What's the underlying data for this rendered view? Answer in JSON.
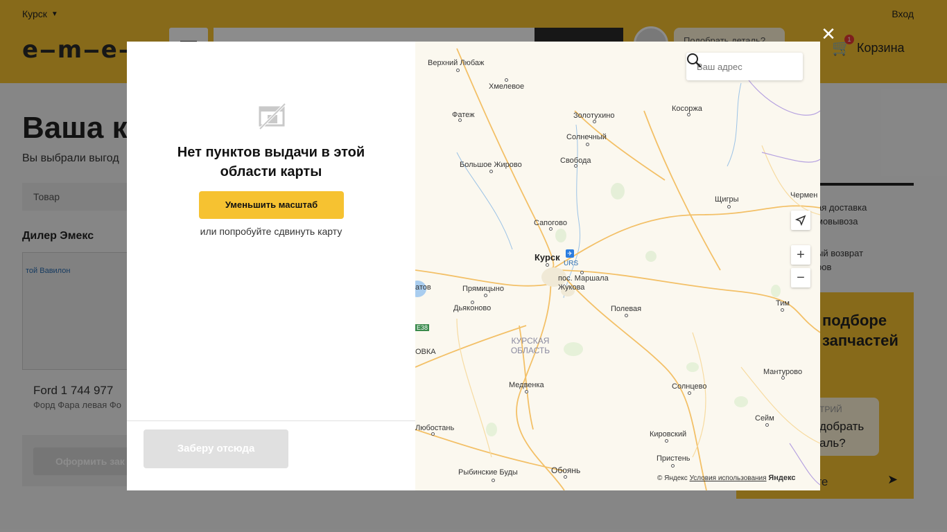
{
  "header": {
    "city": "Курск",
    "login": "Вход",
    "logo": "e‒m‒e‒x",
    "help_placeholder": "Подобрать деталь?",
    "cart_label": "Корзина",
    "cart_count": "1"
  },
  "page": {
    "title": "Ваша ко",
    "subtitle": "Вы выбрали выгод",
    "table_head": "Товар",
    "dealer": "Дилер Эмекс",
    "minimap_label": "той Вавилон",
    "product_name": "Ford 1 744 977",
    "product_desc": "Форд Фара левая Фо",
    "order_button": "Оформить зак",
    "right_col": {
      "line1": "ая доставка",
      "line2": "мовывоза",
      "line3": "ый возврат",
      "line4": "ров"
    },
    "promo": {
      "title": "подборе\nзапчастей",
      "chat_who": "ТРИЙ",
      "chat_msg": "добрать\nаль?",
      "input_text": "авайте"
    }
  },
  "modal": {
    "no_points_title": "Нет пунктов выдачи в этой области карты",
    "zoom_out_button": "Уменьшить масштаб",
    "or_text": "или попробуйте сдвинуть карту",
    "pickup_button": "Заберу отсюда",
    "address_placeholder": "Ваш адрес",
    "copyright": "© Яндекс",
    "terms_link": "Условия использования",
    "yandex_logo": "Яндекс"
  },
  "map": {
    "places": [
      {
        "name": "Верхний Любаж",
        "type": "town"
      },
      {
        "name": "Хмелевое",
        "type": "town"
      },
      {
        "name": "Фатеж",
        "type": "town"
      },
      {
        "name": "Золотухино",
        "type": "town"
      },
      {
        "name": "Косоржа",
        "type": "town"
      },
      {
        "name": "Солнечный",
        "type": "town"
      },
      {
        "name": "Свобода",
        "type": "town"
      },
      {
        "name": "Большое Жирово",
        "type": "town"
      },
      {
        "name": "Щигры",
        "type": "town"
      },
      {
        "name": "Чермен",
        "type": "town"
      },
      {
        "name": "Сапогово",
        "type": "town"
      },
      {
        "name": "Курск",
        "type": "city"
      },
      {
        "name": "URS",
        "type": "airport"
      },
      {
        "name": "пос. Маршала Жукова",
        "type": "town"
      },
      {
        "name": "атов",
        "type": "town"
      },
      {
        "name": "Прямицыно",
        "type": "town"
      },
      {
        "name": "Дьяконово",
        "type": "town"
      },
      {
        "name": "Полевая",
        "type": "town"
      },
      {
        "name": "Тим",
        "type": "town"
      },
      {
        "name": "E38",
        "type": "road"
      },
      {
        "name": "ОВКА",
        "type": "town"
      },
      {
        "name": "КУРСКАЯ ОБЛАСТЬ",
        "type": "region"
      },
      {
        "name": "Мантурово",
        "type": "town"
      },
      {
        "name": "Медвенка",
        "type": "town"
      },
      {
        "name": "Солнцево",
        "type": "town"
      },
      {
        "name": "Сейм",
        "type": "town"
      },
      {
        "name": "Любостань",
        "type": "town"
      },
      {
        "name": "Кировский",
        "type": "town"
      },
      {
        "name": "Пристень",
        "type": "town"
      },
      {
        "name": "Рыбинские Буды",
        "type": "town"
      },
      {
        "name": "Обоянь",
        "type": "town"
      }
    ]
  },
  "colors": {
    "brand": "#f6c231",
    "dark": "#2a2a2a",
    "disabled": "#e0e0e0",
    "map_bg": "#fbf8ef",
    "road": "#f3c067",
    "border": "#9a7fd1"
  },
  "icons": {
    "city_dropdown": "chevron-down-icon",
    "menu": "hamburger-icon",
    "cart": "cart-icon",
    "close": "close-icon",
    "no_points": "no-image-icon",
    "search": "search-icon",
    "locate": "locate-arrow-icon",
    "zoom_in": "plus-icon",
    "zoom_out": "minus-icon",
    "send": "send-icon"
  }
}
